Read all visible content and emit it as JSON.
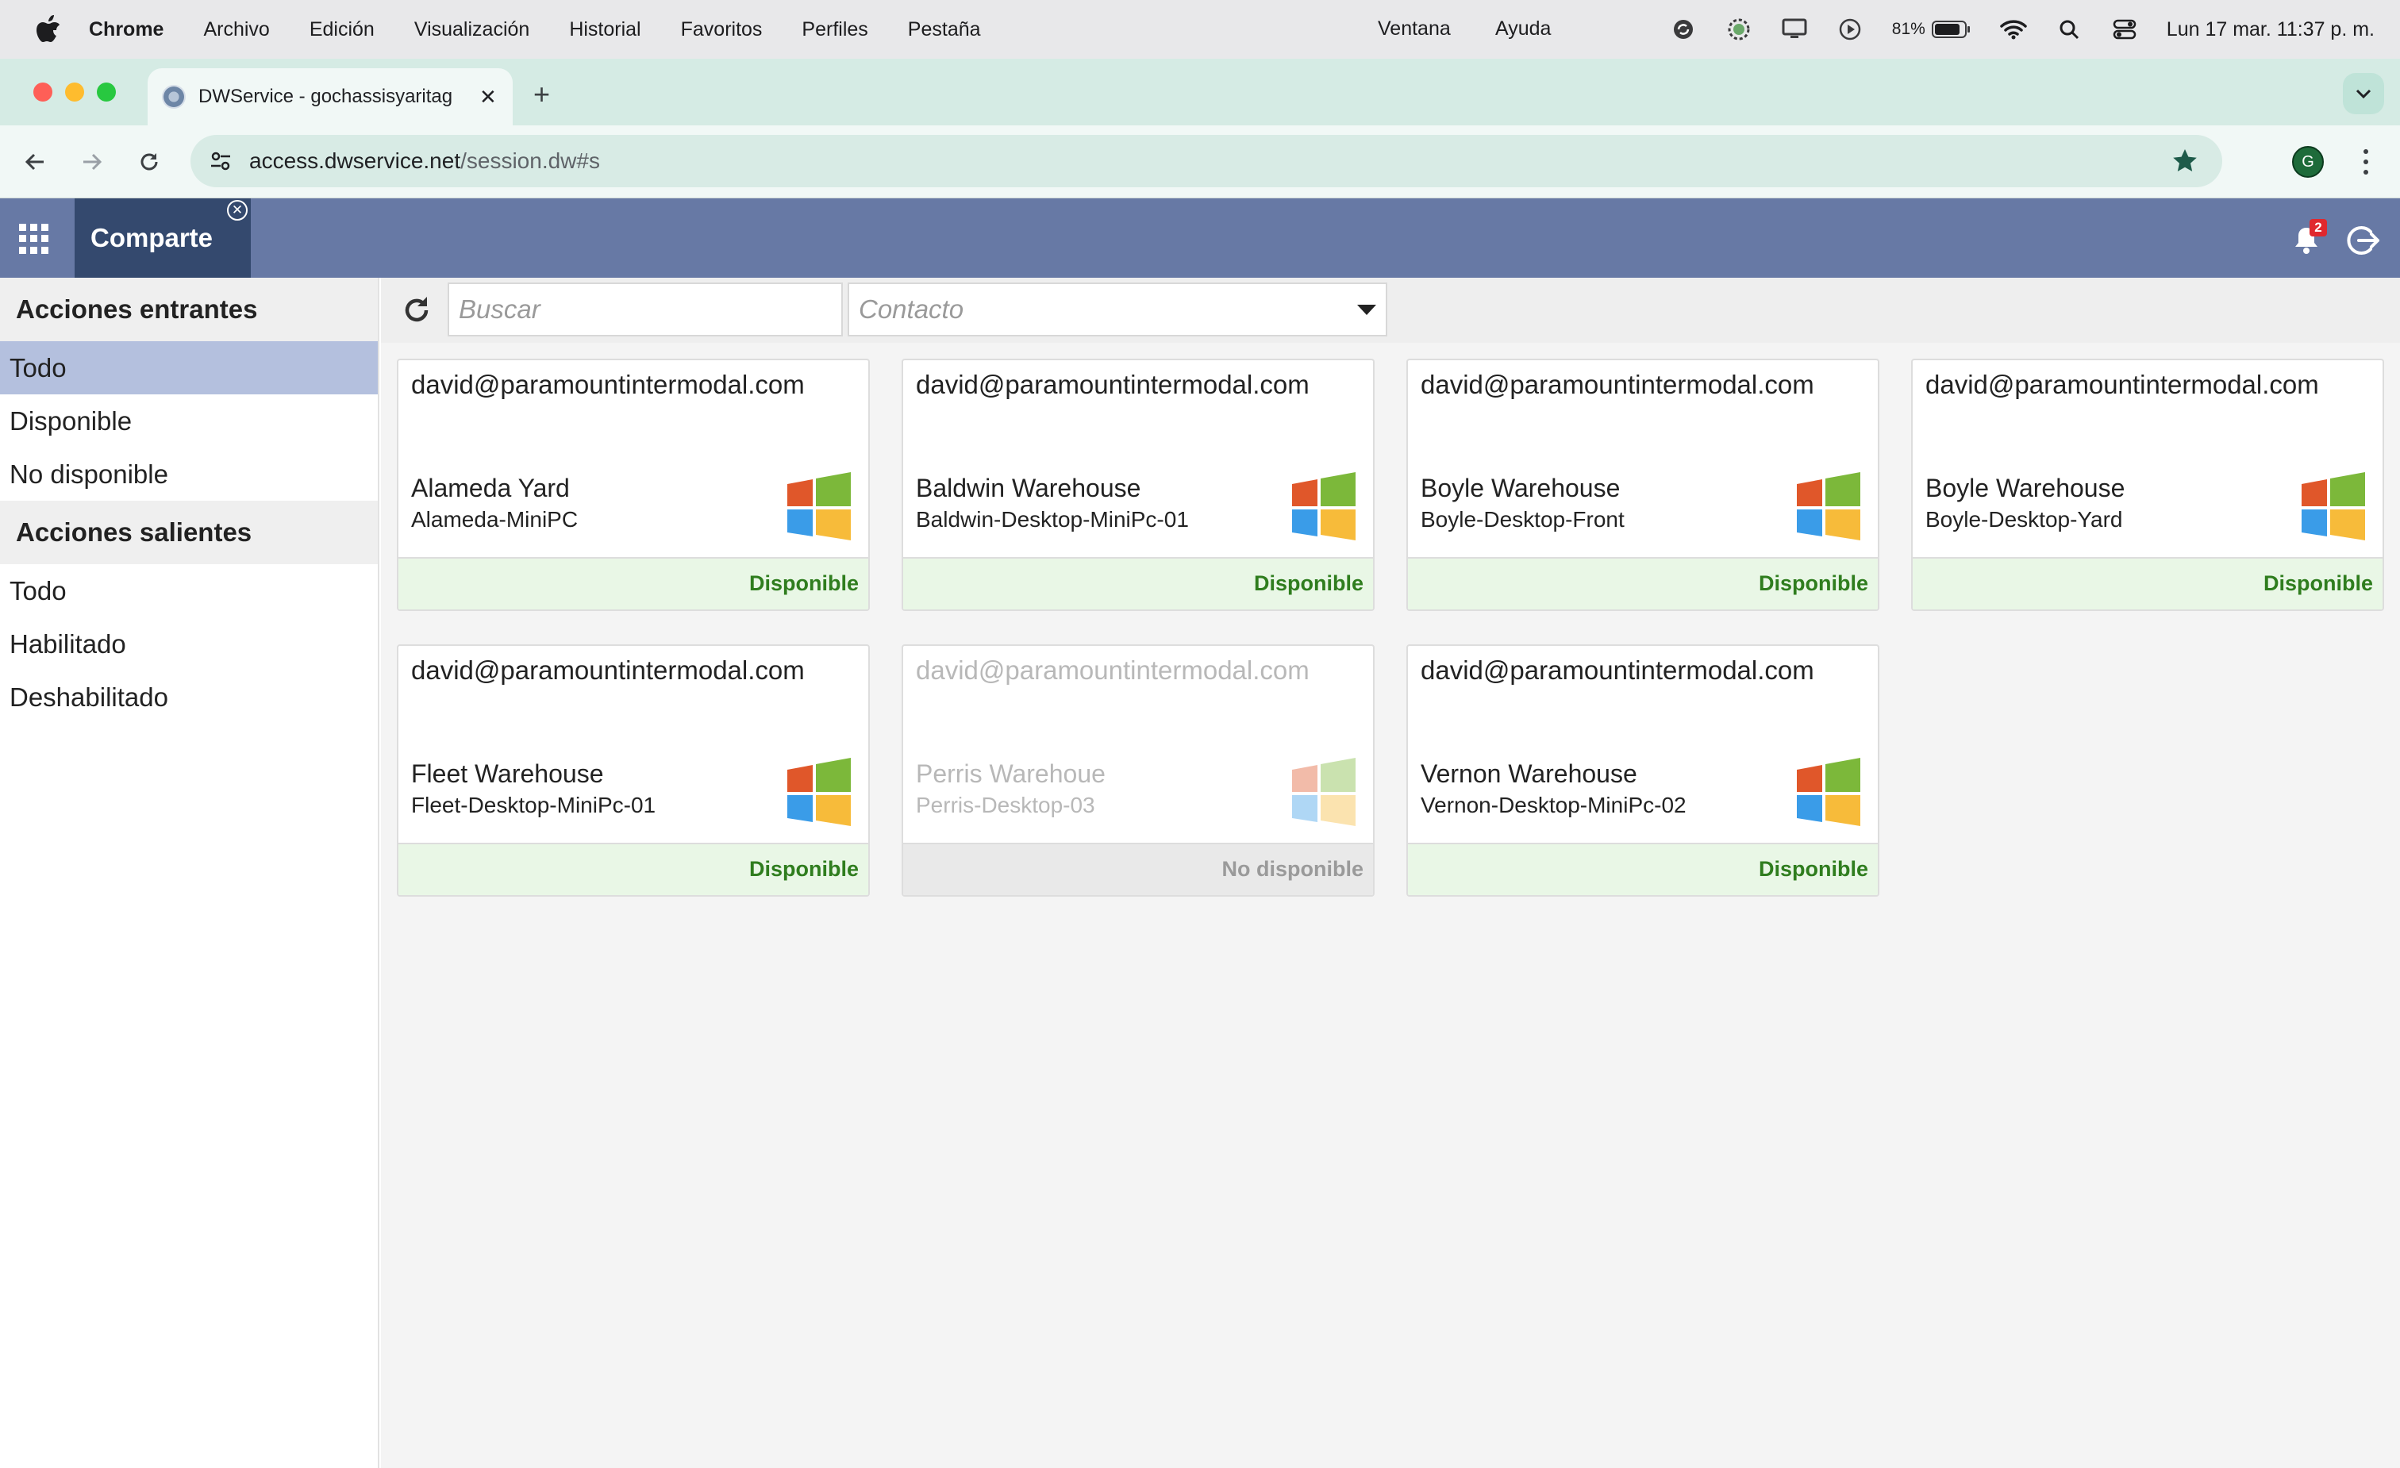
{
  "menubar": {
    "app_name": "Chrome",
    "items": [
      "Archivo",
      "Edición",
      "Visualización",
      "Historial",
      "Favoritos",
      "Perfiles",
      "Pestaña"
    ],
    "ventana": "Ventana",
    "ayuda": "Ayuda",
    "battery": "81%",
    "clock": "Lun 17 mar.  11:37 p. m."
  },
  "browser": {
    "tab_title": "DWService - gochassisyaritag",
    "url_host": "access.dwservice.net",
    "url_path": "/session.dw#s",
    "profile_initial": "G"
  },
  "app": {
    "active_app": "Comparte",
    "notification_count": "2"
  },
  "sidebar": {
    "incoming_header": "Acciones entrantes",
    "incoming_items": [
      "Todo",
      "Disponible",
      "No disponible"
    ],
    "outgoing_header": "Acciones salientes",
    "outgoing_items": [
      "Todo",
      "Habilitado",
      "Deshabilitado"
    ]
  },
  "filters": {
    "search_placeholder": "Buscar",
    "contact_placeholder": "Contacto"
  },
  "cards": [
    {
      "owner": "david@paramountintermodal.com",
      "name": "Alameda Yard",
      "host": "Alameda-MiniPC",
      "status": "Disponible",
      "os": "windows-icon"
    },
    {
      "owner": "david@paramountintermodal.com",
      "name": "Baldwin Warehouse",
      "host": "Baldwin-Desktop-MiniPc-01",
      "status": "Disponible",
      "os": "windows-icon"
    },
    {
      "owner": "david@paramountintermodal.com",
      "name": "Boyle Warehouse",
      "host": "Boyle-Desktop-Front",
      "status": "Disponible",
      "os": "windows-icon"
    },
    {
      "owner": "david@paramountintermodal.com",
      "name": "Boyle Warehouse",
      "host": "Boyle-Desktop-Yard",
      "status": "Disponible",
      "os": "windows-icon"
    },
    {
      "owner": "david@paramountintermodal.com",
      "name": "Fleet Warehouse",
      "host": "Fleet-Desktop-MiniPc-01",
      "status": "Disponible",
      "os": "windows-icon"
    },
    {
      "owner": "david@paramountintermodal.com",
      "name": "Perris Warehoue",
      "host": "Perris-Desktop-03",
      "status": "No disponible",
      "os": "windows-icon"
    },
    {
      "owner": "david@paramountintermodal.com",
      "name": "Vernon Warehouse",
      "host": "Vernon-Desktop-MiniPc-02",
      "status": "Disponible",
      "os": "windows-icon"
    }
  ],
  "colors": {
    "header": "#6779a5",
    "active_app": "#34496e",
    "sidebar_active": "#b4c0de",
    "available": "#2f7d1e",
    "available_bg": "#e9f7e6"
  }
}
